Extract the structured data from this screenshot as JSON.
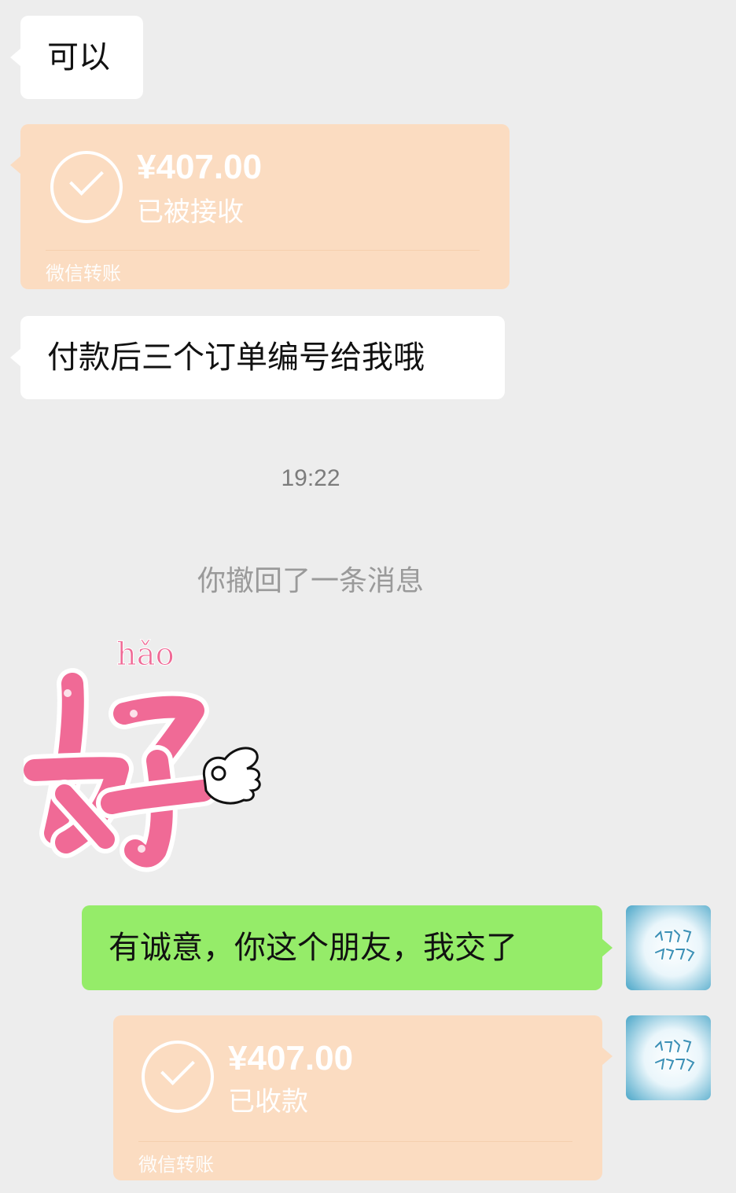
{
  "messages": {
    "m1": {
      "text": "可以"
    },
    "transfer1": {
      "amount": "¥407.00",
      "status": "已被接收",
      "brand": "微信转账"
    },
    "m2": {
      "text": "付款后三个订单编号给我哦"
    },
    "timestamp": "19:22",
    "recall_notice": "你撤回了一条消息",
    "sticker": {
      "pinyin": "hǎo",
      "char": "好"
    },
    "m3": {
      "text": "有诚意，你这个朋友，我交了"
    },
    "transfer2": {
      "amount": "¥407.00",
      "status": "已收款",
      "brand": "微信转账"
    }
  },
  "colors": {
    "background": "#ededed",
    "incoming_bubble": "#ffffff",
    "outgoing_bubble": "#95ec69",
    "transfer_card": "#fbdcc1",
    "sticker_pink": "#f06a96"
  }
}
